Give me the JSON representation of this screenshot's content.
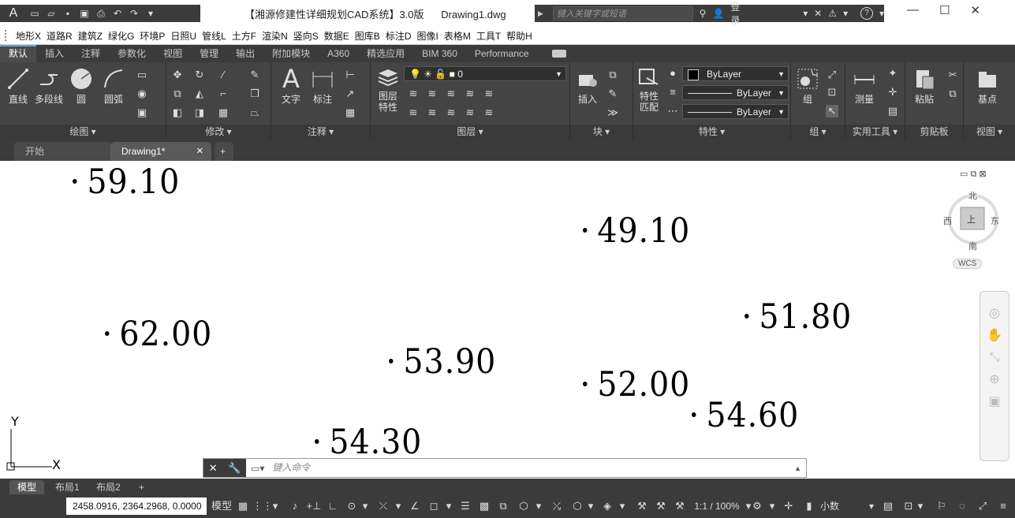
{
  "titlebar": {
    "app_logo": "A",
    "doc_title": "【湘源修建性详细规划CAD系统】3.0版      Drawing1.dwg",
    "search_placeholder": "键入关键字或短语",
    "signin": "登录",
    "help": "?"
  },
  "window_controls": {
    "minimize": "—",
    "maximize": "☐",
    "close": "✕"
  },
  "menu": [
    "地形X",
    "道路R",
    "建筑Z",
    "绿化G",
    "环境P",
    "日照U",
    "管线L",
    "土方F",
    "渲染N",
    "竖向S",
    "数据E",
    "图库B",
    "标注D",
    "图像I",
    "表格M",
    "工具T",
    "帮助H"
  ],
  "ribbon_tabs": [
    "默认",
    "插入",
    "注释",
    "参数化",
    "视图",
    "管理",
    "输出",
    "附加模块",
    "A360",
    "精选应用",
    "BIM 360",
    "Performance"
  ],
  "ribbon_active_tab": "默认",
  "ribbon": {
    "draw": {
      "title": "绘图 ▾",
      "line": "直线",
      "polyline": "多段线",
      "circle": "圆",
      "arc": "圆弧"
    },
    "modify": {
      "title": "修改 ▾"
    },
    "annotation": {
      "title": "注释 ▾",
      "text": "文字",
      "dimension": "标注"
    },
    "layers": {
      "title": "图层 ▾",
      "layer_properties_1": "图层",
      "layer_properties_2": "特性",
      "current_layer": "0"
    },
    "block": {
      "title": "块 ▾",
      "insert": "插入"
    },
    "properties": {
      "title": "特性 ▾",
      "match_1": "特性",
      "match_2": "匹配",
      "color": "ByLayer",
      "linetype": "ByLayer",
      "lineweight": "ByLayer"
    },
    "groups": {
      "title": "组 ▾",
      "group": "组"
    },
    "utilities": {
      "title": "实用工具 ▾",
      "measure": "测量"
    },
    "clipboard": {
      "title": "剪贴板",
      "paste": "粘贴"
    },
    "view": {
      "title": "视图 ▾",
      "base": "基点"
    }
  },
  "file_tabs": {
    "start": "开始",
    "drawing": "Drawing1*",
    "close": "✕",
    "new": "+"
  },
  "drawing_points": [
    "59.10",
    "49.10",
    "62.00",
    "51.80",
    "53.90",
    "52.00",
    "54.60",
    "54.30"
  ],
  "ucs": {
    "y": "Y",
    "x": "X"
  },
  "viewcube": {
    "north": "北",
    "south": "南",
    "east": "东",
    "west": "西",
    "top": "上",
    "wcs": "WCS"
  },
  "command": {
    "placeholder": "键入命令"
  },
  "layout_tabs": [
    "模型",
    "布局1",
    "布局2",
    "+"
  ],
  "status": {
    "coords": "2458.0916, 2364.2968, 0.0000",
    "model": "模型",
    "scale": "1:1 / 100%",
    "units": "小数"
  }
}
